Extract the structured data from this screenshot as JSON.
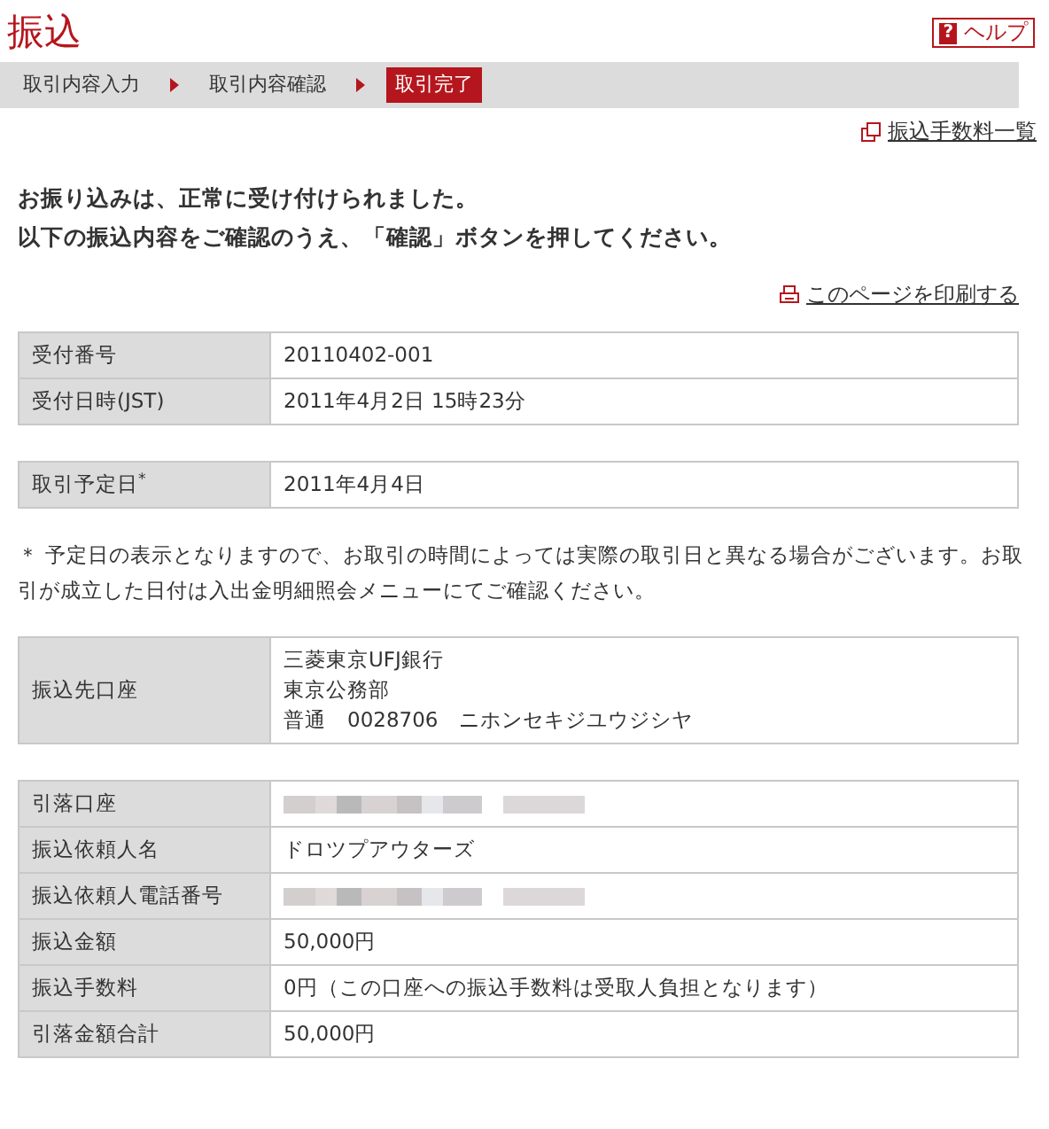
{
  "title": "振込",
  "help": {
    "label": "ヘルプ",
    "icon_char": "?"
  },
  "steps": [
    {
      "label": "取引内容入力",
      "selected": false
    },
    {
      "label": "取引内容確認",
      "selected": false
    },
    {
      "label": "取引完了",
      "selected": true
    }
  ],
  "fee_link": "振込手数料一覧",
  "messages": [
    "お振り込みは、正常に受け付けられました。",
    "以下の振込内容をご確認のうえ、「確認」ボタンを押してください。"
  ],
  "print_link": "このページを印刷する",
  "sections": [
    {
      "kind": "table",
      "rows": [
        {
          "label": "受付番号",
          "lines": [
            "20110402-001"
          ]
        },
        {
          "label": "受付日時(JST)",
          "lines": [
            "2011年4月2日 15時23分"
          ]
        }
      ]
    },
    {
      "kind": "table",
      "rows": [
        {
          "label": "取引予定日$^{*}$",
          "lines": [
            "2011年4月4日"
          ]
        }
      ]
    },
    {
      "kind": "note",
      "text": "＊ 予定日の表示となりますので、お取引の時間によっては実際の取引日と異なる場合がございます。お取引が成立した日付は入出金明細照会メニューにてご確認ください。"
    },
    {
      "kind": "table",
      "rows": [
        {
          "label": "振込先口座",
          "lines": [
            "三菱東京UFJ銀行",
            "東京公務部",
            "普通　0028706　ニホンセキジユウジシヤ"
          ]
        }
      ]
    },
    {
      "kind": "table",
      "rows": [
        {
          "label": "引落口座",
          "redacted": true
        },
        {
          "label": "振込依頼人名",
          "lines": [
            "ドロツプアウターズ"
          ]
        },
        {
          "label": "振込依頼人電話番号",
          "redacted": true
        },
        {
          "label": "振込金額",
          "lines": [
            "50,000円"
          ]
        },
        {
          "label": "振込手数料",
          "lines": [
            "0円（この口座への振込手数料は受取人負担となります）"
          ]
        },
        {
          "label": "引落金額合計",
          "lines": [
            "50,000円"
          ]
        }
      ]
    }
  ]
}
